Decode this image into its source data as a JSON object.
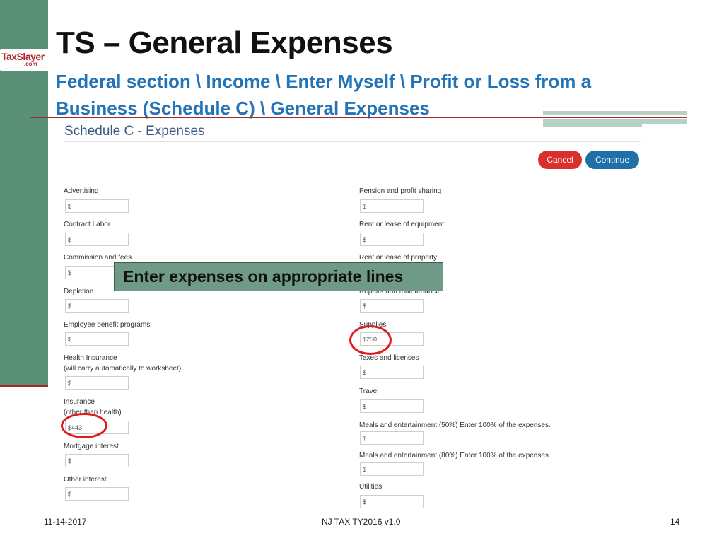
{
  "slide": {
    "logo_text": "TaxSlayer",
    "logo_sub": ".com",
    "title": "TS – General Expenses",
    "subtitle": "Federal section \\ Income \\ Enter Myself \\ Profit or Loss from a Business (Schedule C) \\ General Expenses"
  },
  "form": {
    "title": "Schedule C - Expenses",
    "cancel_label": "Cancel",
    "continue_label": "Continue",
    "left_fields": [
      {
        "label": "Advertising",
        "value": "$"
      },
      {
        "label": "Contract Labor",
        "value": "$"
      },
      {
        "label": "Commission and fees",
        "value": "$"
      },
      {
        "label": "Depletion",
        "value": "$"
      },
      {
        "label": "Employee benefit programs",
        "value": "$"
      },
      {
        "label": "Health Insurance",
        "label2": "(will carry automatically to worksheet)",
        "value": "$"
      },
      {
        "label": "Insurance",
        "label2": "(other than health)",
        "value": "$443"
      },
      {
        "label": "Mortgage interest",
        "value": "$"
      },
      {
        "label": "Other interest",
        "value": "$"
      }
    ],
    "right_fields": [
      {
        "label": "Pension and profit sharing",
        "value": "$"
      },
      {
        "label": "Rent or lease of equipment",
        "value": "$"
      },
      {
        "label": "Rent or lease of property",
        "value": "$"
      },
      {
        "label": "Repairs and maintenance",
        "value": "$"
      },
      {
        "label": "Supplies",
        "value": "$250"
      },
      {
        "label": "Taxes and licenses",
        "value": "$"
      },
      {
        "label": "Travel",
        "value": "$"
      },
      {
        "label": "Meals and entertainment (50%) Enter 100% of the expenses.",
        "value": "$"
      },
      {
        "label": "Meals and entertainment (80%) Enter 100% of the expenses.",
        "value": "$"
      },
      {
        "label": "Utilities",
        "value": "$"
      }
    ]
  },
  "callout": "Enter expenses on appropriate lines",
  "footer": {
    "date": "11-14-2017",
    "center": "NJ TAX TY2016 v1.0",
    "page": "14"
  },
  "colors": {
    "sidebar": "#5a9078",
    "accent_red": "#a4282c",
    "subtitle_blue": "#2273b8",
    "cancel": "#d9302e",
    "continue": "#1f6fa8",
    "highlight_circle": "#e01b1b"
  }
}
